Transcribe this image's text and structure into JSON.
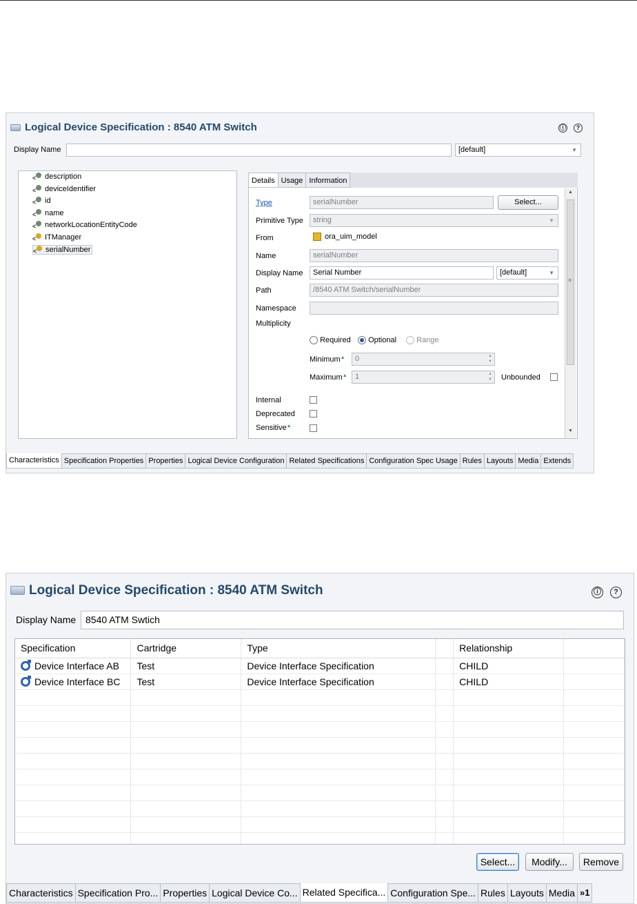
{
  "top": {
    "title": "Logical Device Specification : 8540 ATM Switch",
    "info_glyph": "ⓘ",
    "help_glyph": "?",
    "display_name_label": "Display Name",
    "display_name_value": "",
    "locale": "[default]",
    "tree": [
      {
        "label": "description",
        "icon": "attribute-icon"
      },
      {
        "label": "deviceIdentifier",
        "icon": "attribute-icon"
      },
      {
        "label": "id",
        "icon": "attribute-icon"
      },
      {
        "label": "name",
        "icon": "attribute-icon"
      },
      {
        "label": "networkLocationEntityCode",
        "icon": "attribute-icon"
      },
      {
        "label": "ITManager",
        "icon": "key-attribute-icon"
      },
      {
        "label": "serialNumber",
        "icon": "key-attribute-icon"
      }
    ],
    "detail_tabs": [
      "Details",
      "Usage",
      "Information"
    ],
    "details": {
      "type_label": "Type",
      "type_value": "serialNumber",
      "select_button": "Select...",
      "primitive_type_label": "Primitive Type",
      "primitive_type_value": "string",
      "from_label": "From",
      "from_value": "ora_uim_model",
      "name_label": "Name",
      "name_value": "serialNumber",
      "display_name_label": "Display Name",
      "display_name_value": "Serial Number",
      "display_locale": "[default]",
      "path_label": "Path",
      "path_value": "/8540 ATM Switch/serialNumber",
      "namespace_label": "Namespace",
      "namespace_value": "",
      "multiplicity_label": "Multiplicity",
      "radio_required": "Required",
      "radio_optional": "Optional",
      "radio_range": "Range",
      "minimum_label": "Minimum",
      "minimum_value": "0",
      "maximum_label": "Maximum",
      "maximum_value": "1",
      "unbounded_label": "Unbounded",
      "internal_label": "Internal",
      "deprecated_label": "Deprecated",
      "sensitive_label": "Sensitive"
    },
    "bottom_tabs": [
      "Characteristics",
      "Specification Properties",
      "Properties",
      "Logical Device Configuration",
      "Related Specifications",
      "Configuration Spec Usage",
      "Rules",
      "Layouts",
      "Media",
      "Extends"
    ]
  },
  "bottom": {
    "title": "Logical Device Specification : 8540 ATM Switch",
    "info_glyph": "ⓘ",
    "help_glyph": "?",
    "display_name_label": "Display Name",
    "display_name_value": "8540 ATM Swtich",
    "columns": [
      "Specification",
      "Cartridge",
      "Type",
      "",
      "Relationship",
      ""
    ],
    "rows": [
      {
        "specification": "Device Interface AB",
        "cartridge": "Test",
        "type": "Device Interface Specification",
        "relationship": "CHILD"
      },
      {
        "specification": "Device Interface BC",
        "cartridge": "Test",
        "type": "Device Interface Specification",
        "relationship": "CHILD"
      }
    ],
    "buttons": {
      "select": "Select...",
      "modify": "Modify...",
      "remove": "Remove"
    },
    "bottom_tabs": [
      "Characteristics",
      "Specification Pro...",
      "Properties",
      "Logical Device Co...",
      "Related Specifica...",
      "Configuration Spe...",
      "Rules",
      "Layouts",
      "Media"
    ],
    "overflow_label": "»1"
  }
}
